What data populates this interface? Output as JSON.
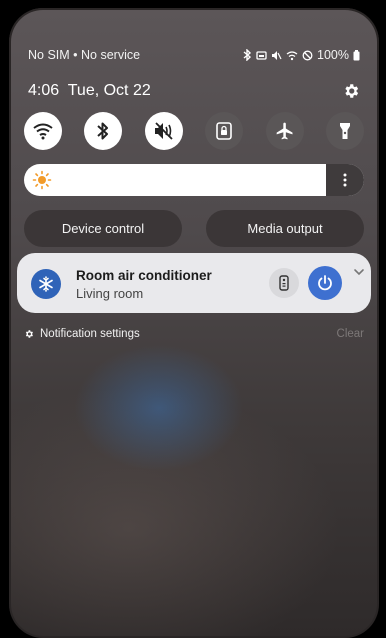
{
  "status_bar": {
    "carrier": "No SIM • No service",
    "battery": "100%",
    "icons": [
      "bluetooth-icon",
      "cast-icon",
      "mute-icon",
      "wifi-icon",
      "dnd-icon",
      "battery-icon"
    ]
  },
  "header": {
    "time_date": "4:06  Tue, Oct 22",
    "settings_icon": "gear-icon"
  },
  "quick_settings": [
    {
      "name": "wifi",
      "state": "on"
    },
    {
      "name": "bluetooth",
      "state": "on"
    },
    {
      "name": "sound-mute",
      "state": "on"
    },
    {
      "name": "screen-lock",
      "state": "off"
    },
    {
      "name": "airplane-mode",
      "state": "off"
    },
    {
      "name": "flashlight",
      "state": "off"
    }
  ],
  "brightness": {
    "icon": "sun-icon",
    "level": 0.9
  },
  "buttons": {
    "device_control": "Device control",
    "media_output": "Media output"
  },
  "notification": {
    "title": "Room air conditioner",
    "subtitle": "Living room",
    "accent": "#3e70d0"
  },
  "footer": {
    "notification_settings": "Notification settings",
    "clear": "Clear"
  }
}
